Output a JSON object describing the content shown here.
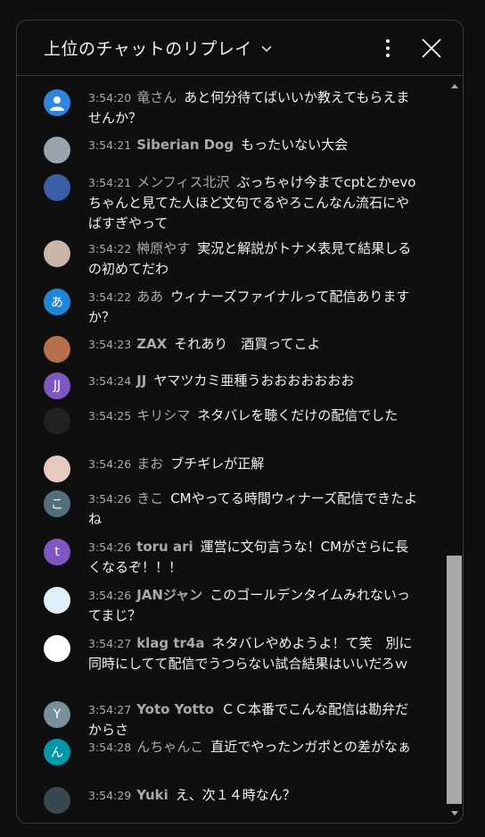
{
  "header": {
    "title": "上位のチャットのリプレイ",
    "dropdown_icon": "chevron-down-icon",
    "more_icon": "more-vert-icon",
    "close_icon": "close-icon"
  },
  "messages": [
    {
      "time": "3:54:20",
      "author": "竜さん",
      "text": "あと何分待てばいいか教えてもらえませんか？",
      "avatar": {
        "bg": "#2e86de",
        "glyph": "person"
      }
    },
    {
      "time": "3:54:21",
      "author": "Siberian Dog",
      "text": "もったいない大会",
      "avatar": {
        "bg": "#9aa4ad",
        "glyph": ""
      }
    },
    {
      "time": "3:54:21",
      "author": "メンフィス北沢",
      "text": "ぶっちゃけ今までcptとかevoちゃんと見てた人ほど文句でるやろこんなん流石にやばすぎやって",
      "avatar": {
        "bg": "#3a5ea8",
        "glyph": ""
      }
    },
    {
      "time": "3:54:22",
      "author": "榊原やす",
      "text": "実況と解説がトナメ表見て結果しるの初めてだわ",
      "avatar": {
        "bg": "#c9b6a8",
        "glyph": ""
      }
    },
    {
      "time": "3:54:22",
      "author": "ああ",
      "text": "ウィナーズファイナルって配信ありますか？",
      "avatar": {
        "bg": "#1e88d6",
        "glyph": "あ"
      }
    },
    {
      "time": "3:54:23",
      "author": "ZAX",
      "text": "それあり　酒買ってこよ",
      "avatar": {
        "bg": "#b5704a",
        "glyph": ""
      }
    },
    {
      "time": "3:54:24",
      "author": "JJ",
      "text": "ヤマツカミ亜種うおおおおおおお",
      "avatar": {
        "bg": "#7e57c2",
        "glyph": "JJ"
      }
    },
    {
      "time": "3:54:25",
      "author": "キリシマ",
      "text": "ネタバレを聴くだけの配信でした",
      "avatar": {
        "bg": "#222222",
        "glyph": ""
      }
    },
    {
      "time": "3:54:26",
      "author": "まお",
      "text": "ブチギレが正解",
      "avatar": {
        "bg": "#e8c9c0",
        "glyph": ""
      }
    },
    {
      "time": "3:54:26",
      "author": "きこ",
      "text": "CMやってる時間ウィナーズ配信できたよね",
      "avatar": {
        "bg": "#546e7a",
        "glyph": "こ"
      }
    },
    {
      "time": "3:54:26",
      "author": "toru ari",
      "text": "運営に文句言うな！CMがさらに長くなるぞ！！！",
      "avatar": {
        "bg": "#7e57c2",
        "glyph": "t"
      }
    },
    {
      "time": "3:54:26",
      "author": "JANジャン",
      "text": "このゴールデンタイムみれないってまじ？",
      "avatar": {
        "bg": "#e0f0f8",
        "glyph": ""
      }
    },
    {
      "time": "3:54:27",
      "author": "klag tr4a",
      "text": "ネタバレやめようよ！て笑　別に同時にしてて配信でうつらない試合結果はいいだろｗ",
      "avatar": {
        "bg": "#ffffff",
        "glyph": ""
      }
    },
    {
      "time": "3:54:27",
      "author": "Yoto Yotto",
      "text": "ＣＣ本番でこんな配信は勘弁だからさ",
      "avatar": {
        "bg": "#78909c",
        "glyph": "Y"
      }
    },
    {
      "time": "3:54:28",
      "author": "んちゃんこ",
      "text": "直近でやったンガポとの差がなぁ",
      "avatar": {
        "bg": "#0097a7",
        "glyph": "ん"
      }
    },
    {
      "time": "3:54:29",
      "author": "Yuki",
      "text": "え、次１４時なん？",
      "avatar": {
        "bg": "#37474f",
        "glyph": ""
      }
    }
  ]
}
